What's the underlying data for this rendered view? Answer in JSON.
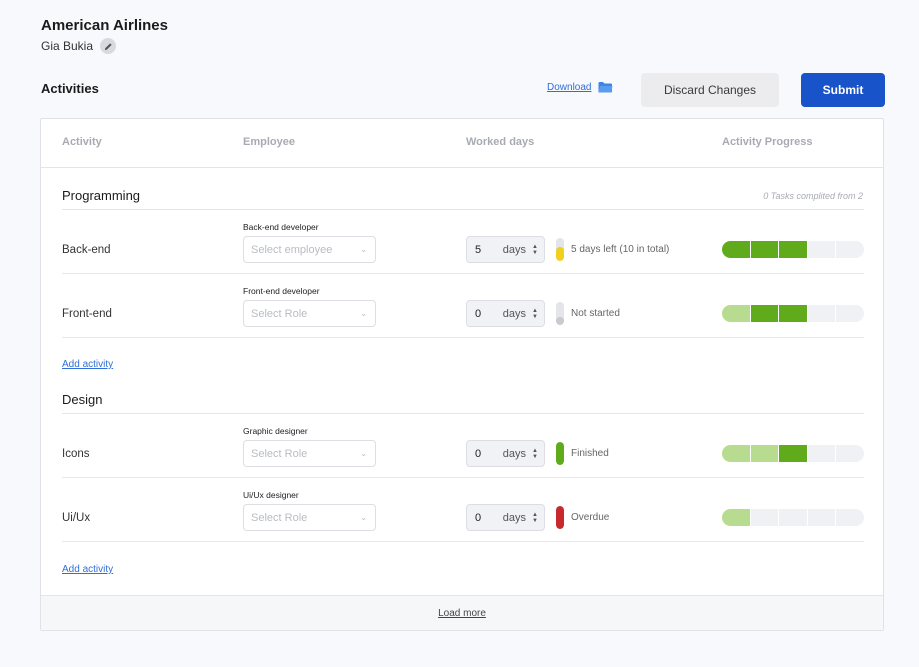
{
  "header": {
    "company": "American Airlines",
    "user": "Gia Bukia",
    "edit_icon": "pencil-icon"
  },
  "toolbar": {
    "section_title": "Activities",
    "download_label": "Download",
    "download_icon": "folder-icon",
    "discard_label": "Discard Changes",
    "submit_label": "Submit"
  },
  "table": {
    "columns": [
      "Activity",
      "Employee",
      "Worked days",
      "Activity Progress"
    ]
  },
  "colors": {
    "accent": "#1853c9",
    "link": "#2f6fd6",
    "progress_dark": "#5fab1b",
    "progress_light": "#b8dc8f",
    "status_yellow": "#f0cf1f",
    "status_green": "#5fab1b",
    "status_red": "#c7292c",
    "status_grey": "#c8cacf"
  },
  "groups": [
    {
      "title": "Programming",
      "summary": "0 Tasks complited from 2",
      "add_label": "Add activity",
      "activities": [
        {
          "name": "Back-end",
          "role": "Back-end developer",
          "select_placeholder": "Select employee",
          "days": "5",
          "unit": "days",
          "status": "5 days left (10 in total)",
          "status_color": "#f0cf1f",
          "status_level": 0.6,
          "progress": [
            "dark",
            "dark",
            "dark",
            "empty",
            "empty"
          ]
        },
        {
          "name": "Front-end",
          "role": "Front-end developer",
          "select_placeholder": "Select Role",
          "days": "0",
          "unit": "days",
          "status": "Not started",
          "status_color": "#c8cacf",
          "status_level": 0.35,
          "progress": [
            "light",
            "dark",
            "dark",
            "empty",
            "empty"
          ]
        }
      ]
    },
    {
      "title": "Design",
      "summary": "",
      "add_label": "Add activity",
      "activities": [
        {
          "name": "Icons",
          "role": "Graphic designer",
          "select_placeholder": "Select Role",
          "days": "0",
          "unit": "days",
          "status": "Finished",
          "status_color": "#5fab1b",
          "status_level": 1.0,
          "progress": [
            "light",
            "light",
            "dark",
            "empty",
            "empty"
          ]
        },
        {
          "name": "Ui/Ux",
          "role": "Ui/Ux designer",
          "select_placeholder": "Select Role",
          "days": "0",
          "unit": "days",
          "status": "Overdue",
          "status_color": "#c7292c",
          "status_level": 1.0,
          "progress": [
            "light",
            "empty",
            "empty",
            "empty",
            "empty"
          ]
        }
      ]
    }
  ],
  "footer": {
    "load_more_label": "Load more"
  }
}
